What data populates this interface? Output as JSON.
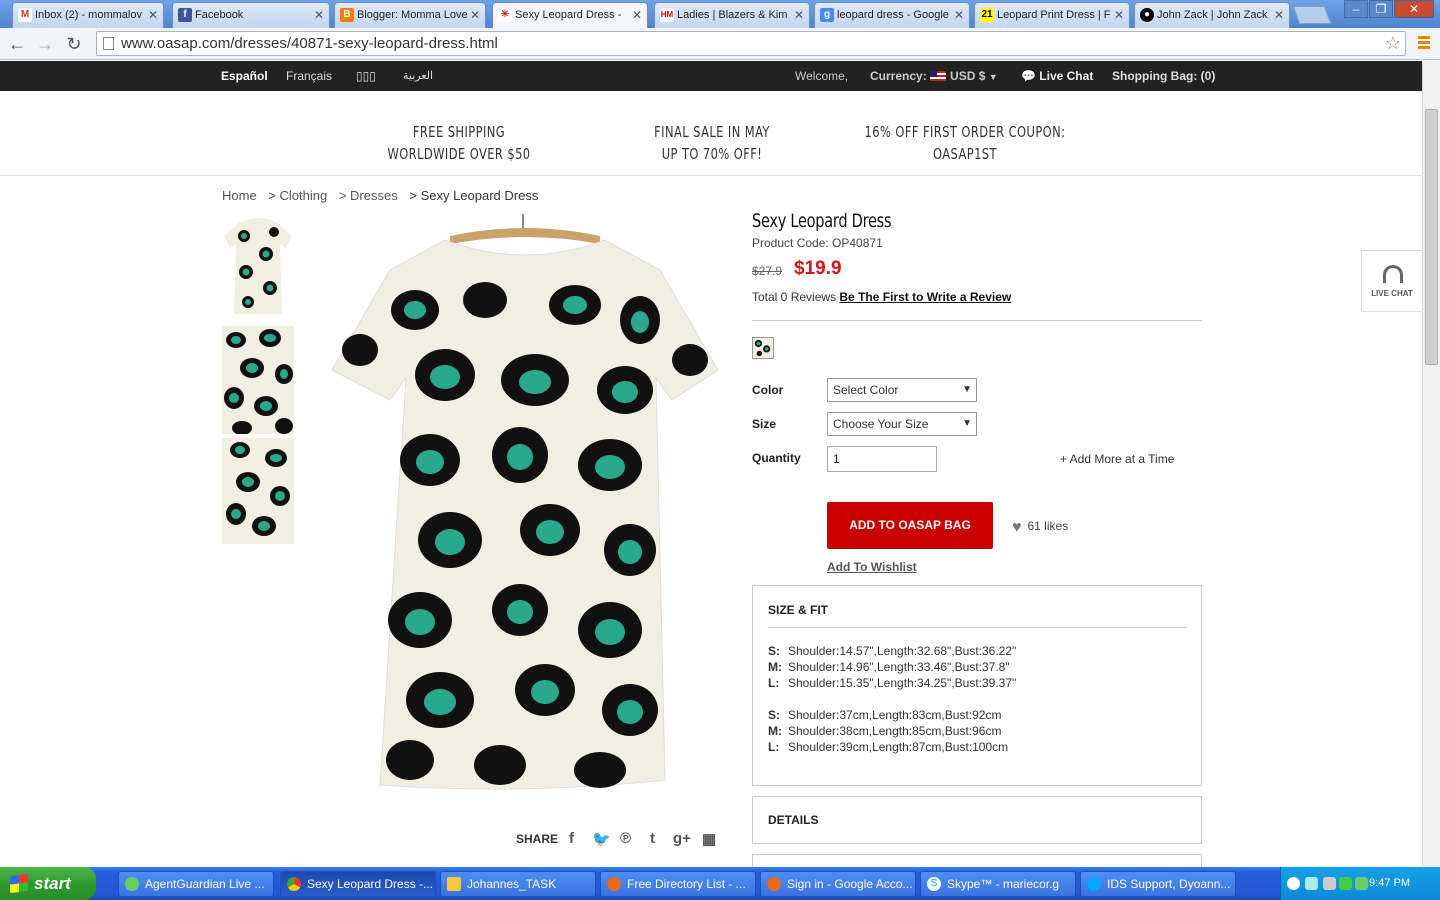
{
  "browser": {
    "tabs": [
      {
        "label": "Inbox (2) - mommalov",
        "icon": "gmail-icon"
      },
      {
        "label": "Facebook",
        "icon": "facebook-icon"
      },
      {
        "label": "Blogger: Momma Love",
        "icon": "blogger-icon"
      },
      {
        "label": "Sexy Leopard Dress -",
        "icon": "oasap-icon"
      },
      {
        "label": "Ladies | Blazers & Kim",
        "icon": "hm-icon"
      },
      {
        "label": "leopard dress - Google",
        "icon": "google-icon"
      },
      {
        "label": "Leopard Print Dress | F",
        "icon": "forever21-icon"
      },
      {
        "label": "John Zack | John Zack",
        "icon": "johnzack-icon"
      }
    ],
    "url": "www.oasap.com/dresses/40871-sexy-leopard-dress.html"
  },
  "topbar": {
    "languages": [
      "Español",
      "Français",
      "▯▯▯",
      "العربية"
    ],
    "welcome": "Welcome,",
    "currency_label": "Currency:",
    "currency_value": "USD $",
    "live_chat": "Live Chat",
    "shopping_bag": "Shopping Bag: (0)"
  },
  "promo": {
    "item1": {
      "line1": "FREE SHIPPING",
      "line2": "WORLDWIDE OVER $50"
    },
    "item2": {
      "line1": "FINAL SALE IN MAY",
      "line2": "UP TO 70% OFF!"
    },
    "item3": {
      "line1": "16% OFF FIRST ORDER COUPON:",
      "line2": "OASAP1ST"
    }
  },
  "breadcrumb": [
    "Home",
    "> Clothing",
    "> Dresses",
    "> Sexy Leopard Dress"
  ],
  "product": {
    "title": "Sexy Leopard Dress",
    "code": "Product Code: OP40871",
    "old_price": "$27.9",
    "price": "$19.9",
    "reviews_text": "Total 0 Reviews",
    "review_link": "Be The First to Write a Review",
    "color_label": "Color",
    "color_placeholder": "Select Color",
    "size_label": "Size",
    "size_placeholder": "Choose Your Size",
    "quantity_label": "Quantity",
    "quantity_value": "1",
    "add_more": "+ Add More at a Time",
    "add_to_bag": "ADD TO OASAP BAG",
    "likes": "61  likes",
    "wishlist": "Add To Wishlist"
  },
  "size_fit": {
    "heading": "SIZE & FIT",
    "inches": [
      {
        "size": "S:",
        "value": "Shoulder:14.57\",Length:32.68\",Bust:36.22\""
      },
      {
        "size": "M:",
        "value": "Shoulder:14.96\",Length:33.46\",Bust:37.8\""
      },
      {
        "size": "L:",
        "value": "Shoulder:15.35\",Length:34.25\",Bust:39.37\""
      }
    ],
    "cm": [
      {
        "size": "S:",
        "value": "Shoulder:37cm,Length:83cm,Bust:92cm"
      },
      {
        "size": "M:",
        "value": "Shoulder:38cm,Length:85cm,Bust:96cm"
      },
      {
        "size": "L:",
        "value": "Shoulder:39cm,Length:87cm,Bust:100cm"
      }
    ]
  },
  "details_heading": "DETAILS",
  "share_label": "SHARE",
  "live_chat_widget": "LIVE CHAT",
  "colors": {
    "price_red": "#d11111",
    "button_red": "#c80000",
    "leopard_teal": "#2aa88c"
  },
  "taskbar": {
    "start": "start",
    "items": [
      "AgentGuardian Live ...",
      "Sexy Leopard Dress -...",
      "Johannes_TASK",
      "Free Directory List - ...",
      "Sign in - Google Acco...",
      "Skype™ - mariecor.g",
      "IDS Support, Dyoann..."
    ],
    "clock": "9:47 PM"
  }
}
